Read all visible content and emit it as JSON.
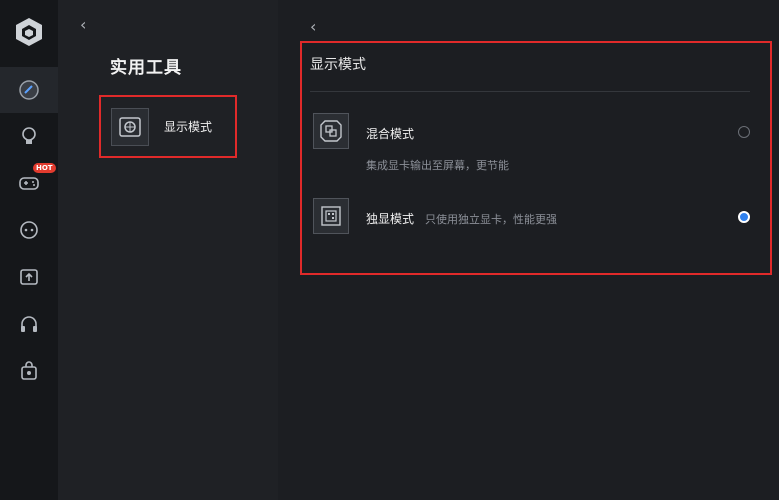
{
  "tools_panel": {
    "title": "实用工具",
    "items": [
      {
        "label": "显示模式"
      }
    ]
  },
  "display_mode": {
    "title": "显示模式",
    "options": [
      {
        "name": "混合模式",
        "description": "集成显卡输出至屏幕，更节能",
        "selected": false
      },
      {
        "name": "独显模式",
        "description": "只使用独立显卡，性能更强",
        "selected": true
      }
    ]
  },
  "sidebar": {
    "hot_badge": "HOT"
  },
  "colors": {
    "accent_red": "#e02a2a",
    "radio_blue": "#2f80ed"
  }
}
